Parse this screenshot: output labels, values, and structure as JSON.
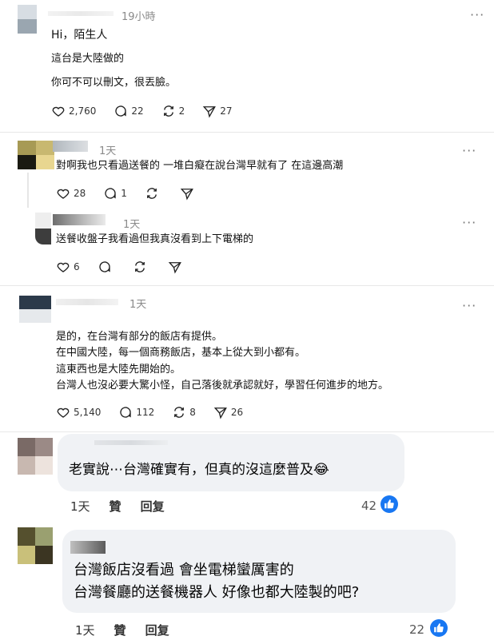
{
  "post1": {
    "time": "19小時",
    "lines": [
      "Hi，陌生人",
      "這台是大陸做的",
      "你可不可以刪文，很丟臉。"
    ],
    "likes": "2,760",
    "comments": "22",
    "reposts": "2",
    "shares": "27"
  },
  "reply1": {
    "time": "1天",
    "text": "對啊我也只看過送餐的 一堆白癡在說台灣早就有了 在這邊高潮",
    "likes": "28",
    "comments": "1"
  },
  "reply2": {
    "time": "1天",
    "text": "送餐收盤子我看過但我真沒看到上下電梯的",
    "likes": "6"
  },
  "post2": {
    "time": "1天",
    "lines": [
      "是的，在台灣有部分的飯店有提供。",
      "在中國大陸，每一個商務飯店，基本上從大到小都有。",
      "這東西也是大陸先開始的。",
      "台灣人也沒必要大驚小怪，自己落後就承認就好，學習任何進步的地方。"
    ],
    "likes": "5,140",
    "comments": "112",
    "reposts": "8",
    "shares": "26"
  },
  "fb_comment1": {
    "text": "老實說⋯台灣確實有，但真的沒這麼普及😂",
    "time": "1天",
    "like_label": "贊",
    "reply_label": "回复",
    "like_count": "42"
  },
  "fb_comment2": {
    "lines": [
      "台灣飯店沒看過 會坐電梯蠻厲害的",
      "台灣餐廳的送餐機器人 好像也都大陸製的吧?"
    ],
    "time": "1天",
    "like_label": "贊",
    "reply_label": "回复",
    "like_count": "22"
  },
  "icons": {
    "more": "more-icon",
    "heart": "heart-icon",
    "comment": "comment-icon",
    "repost": "repost-icon",
    "share": "share-icon",
    "thumbs_up": "thumbs-up-icon"
  },
  "colors": {
    "fb_blue": "#1877f2",
    "bubble_bg": "#f0f2f5",
    "muted": "#8a8a8a"
  }
}
